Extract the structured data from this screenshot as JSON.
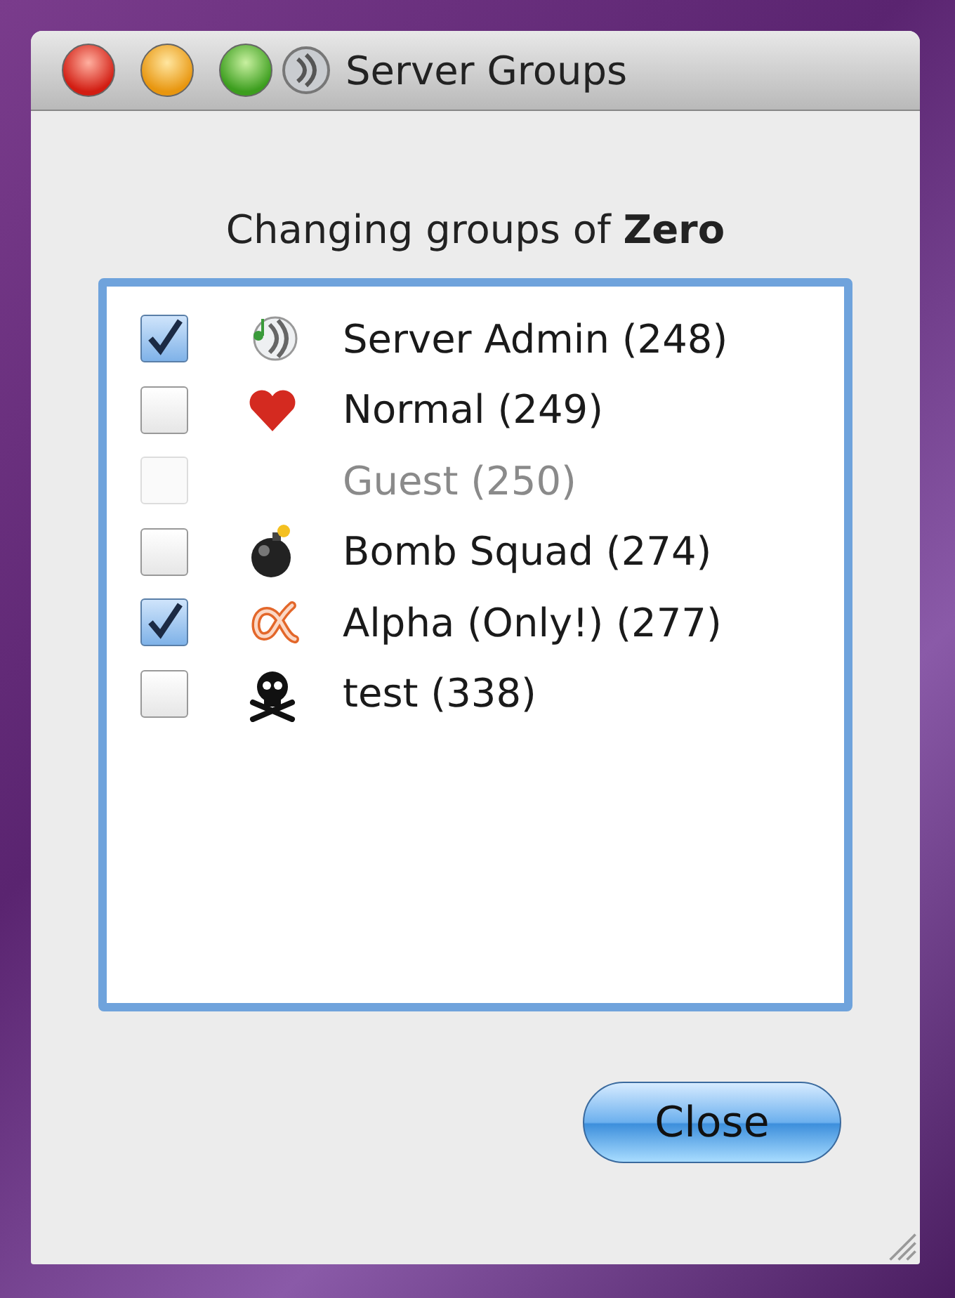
{
  "window": {
    "title": "Server Groups"
  },
  "heading": "Changing groups of **Zero**",
  "groups": [
    {
      "label": "Server Admin (248)",
      "checked": true,
      "disabled": false,
      "kind": "speaker"
    },
    {
      "label": "Normal (249)",
      "checked": false,
      "disabled": false,
      "kind": "heart"
    },
    {
      "label": "Guest (250)",
      "checked": false,
      "disabled": true,
      "kind": "none"
    },
    {
      "label": "Bomb Squad (274)",
      "checked": false,
      "disabled": false,
      "kind": "bomb"
    },
    {
      "label": "Alpha (Only!) (277)",
      "checked": true,
      "disabled": false,
      "kind": "loop"
    },
    {
      "label": "test (338)",
      "checked": false,
      "disabled": false,
      "kind": "skull"
    }
  ],
  "buttons": [
    {
      "label": "Close"
    }
  ]
}
